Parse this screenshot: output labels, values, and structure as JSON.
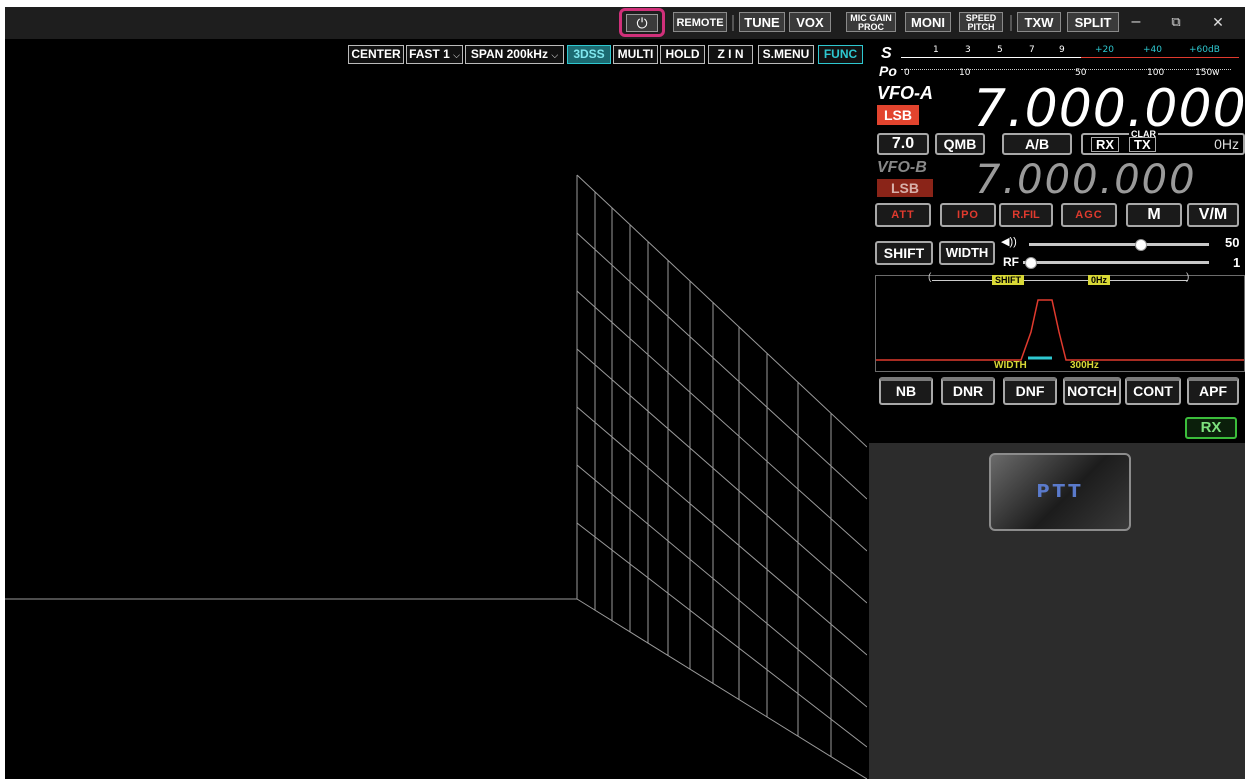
{
  "titlebar": {
    "remote": "REMOTE",
    "tune": "TUNE",
    "vox": "VOX",
    "mic_gain": "MIC GAIN",
    "proc": "PROC",
    "moni": "MONI",
    "speed": "SPEED",
    "pitch": "PITCH",
    "txw": "TXW",
    "split": "SPLIT",
    "minimize": "–",
    "restore": "⧉",
    "close": "✕",
    "power_glyph": "⏻"
  },
  "toolbar": {
    "center": "CENTER",
    "fast": "FAST 1",
    "span": "SPAN  200kHz",
    "dss": "3DSS",
    "multi": "MULTI",
    "hold": "HOLD",
    "zin": "Z I N",
    "smenu": "S.MENU",
    "func": "FUNC"
  },
  "meter": {
    "s_label": "S",
    "s_scale": [
      "1",
      "3",
      "5",
      "7",
      "9",
      "+20",
      "+40",
      "+60dB"
    ],
    "po_label": "Po",
    "po_scale": [
      "0",
      "10",
      "50",
      "100",
      "150w"
    ]
  },
  "vfo_a": {
    "label": "VFO-A",
    "mode": "LSB",
    "freq": "7.000.000"
  },
  "vfo_b": {
    "label": "VFO-B",
    "mode": "LSB",
    "freq": "7.000.000"
  },
  "band": {
    "band": "7.0",
    "qmb": "QMB",
    "ab": "A/B",
    "clar": "CLAR",
    "rx": "RX",
    "tx": "TX",
    "offset": "0Hz"
  },
  "func_row": {
    "att": "ATT",
    "ipo": "IPO",
    "rfil": "R.FIL",
    "agc": "AGC",
    "m": "M",
    "vm": "V/M"
  },
  "levels": {
    "shift": "SHIFT",
    "width": "WIDTH",
    "af_value": "50",
    "rf_label": "RF",
    "rf_value": "1",
    "af_level": 0.62,
    "rf_level": 0.01
  },
  "filter": {
    "shift_label": "SHIFT",
    "shift_value": "0Hz",
    "width_label": "WIDTH",
    "width_value": "300Hz"
  },
  "dsp": {
    "nb": "NB",
    "dnr": "DNR",
    "dnf": "DNF",
    "notch": "NOTCH",
    "cont": "CONT",
    "apf": "APF"
  },
  "status": {
    "rx": "RX"
  },
  "ptt": {
    "label": "PTT"
  },
  "colors": {
    "accent_cyan": "#2ec8d0",
    "vfo_red": "#e2442e",
    "power_highlight": "#d0307a",
    "rx_green": "#3bbd3b"
  }
}
